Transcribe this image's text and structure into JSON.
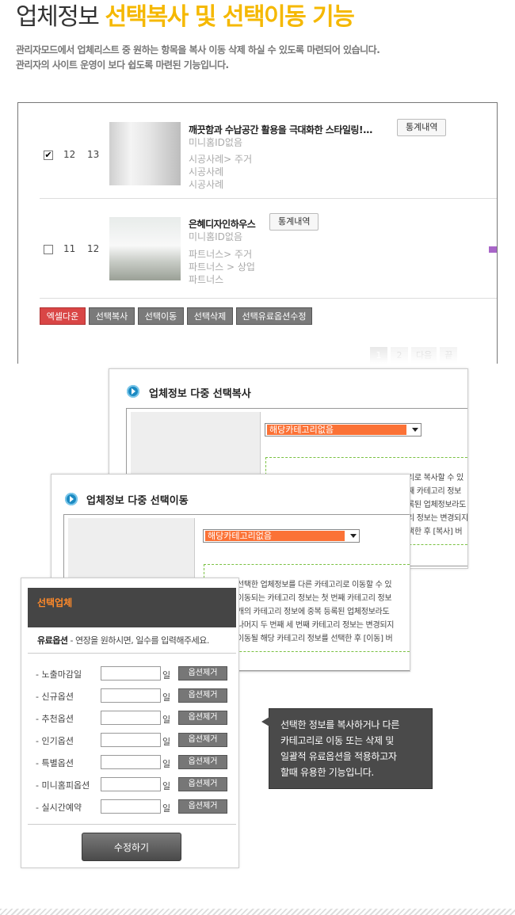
{
  "header": {
    "title_plain": "업체정보",
    "title_highlight": "선택복사 및 선택이동 기능",
    "desc_line1": "관리자모드에서 업체리스트 중 원하는 항목을 복사 이동 삭제 하실 수 있도록 마련되어 있습니다.",
    "desc_line2": "관리자의 사이트 운영이 보다 쉽도록 마련된 기능입니다."
  },
  "list": {
    "rows": [
      {
        "checked": true,
        "check_glyph": "✔",
        "no": "12",
        "id": "13",
        "name": "깨끗함과 수납공간 활용을 극대화한 스타일링!...",
        "stat_label": "통계내역",
        "homepage": "미니홈ID없음",
        "cat1": "시공사례> 주거",
        "cat2": "시공사례",
        "cat3": "시공사례"
      },
      {
        "checked": false,
        "check_glyph": "",
        "no": "11",
        "id": "12",
        "name": "은혜디자인하우스",
        "stat_label": "통계내역",
        "homepage": "미니홈ID없음",
        "cat1": "파트너스> 주거",
        "cat2": "파트너스 > 상업",
        "cat3": "파트너스"
      }
    ],
    "buttons": {
      "excel": "엑셀다운",
      "copy": "선택복사",
      "move": "선택이동",
      "delete": "선택삭제",
      "paid_edit": "선택유료옵션수정"
    },
    "pager": [
      "1",
      "2",
      "다음",
      "끝"
    ]
  },
  "copy_window": {
    "title": "업체정보 다중 선택복사",
    "select_value": "해당카테고리없음",
    "info_lines": [
      "리로 복사할 수 있",
      "째 카테고리 정보",
      "록된 업체정보라도",
      "리 정보는 변경되지",
      "택한 후 [복사] 버"
    ]
  },
  "move_window": {
    "title": "업체정보 다중 선택이동",
    "select_value": "해당카테고리없음",
    "info_lines": [
      "선택한 업체정보를 다른 카테고리로 이동할 수 있",
      "이동되는 카테고리 정보는 첫 번째 카테고리 정보",
      "개의 카테고리 정보에 중복 등록된 업체정보라도",
      "나머지 두 번째 세 번째 카테고리 정보는 변경되지",
      "이동될 해당 카테고리 정보를 선택한 후 [이동] 버"
    ]
  },
  "option_panel": {
    "title": "선택업체",
    "subtitle_bold": "유료옵션",
    "subtitle_rest": " - 연장을 원하시면, 일수를 입력해주세요.",
    "day_unit": "일",
    "remove_label": "옵션제거",
    "rows": [
      {
        "label": "- 노출마감일",
        "value": ""
      },
      {
        "label": "- 신규옵션",
        "value": ""
      },
      {
        "label": "- 추천옵션",
        "value": ""
      },
      {
        "label": "- 인기옵션",
        "value": ""
      },
      {
        "label": "- 특별옵션",
        "value": ""
      },
      {
        "label": "- 미니홈피옵션",
        "value": ""
      },
      {
        "label": "- 실시간예약",
        "value": ""
      }
    ],
    "save_label": "수정하기"
  },
  "tooltip": {
    "text": "선택한 정보를 복사하거나 다른\n카테고리로 이동 또는 삭제 및\n일괄적 유료옵션을 적용하고자\n할때 유용한 기능입니다."
  }
}
